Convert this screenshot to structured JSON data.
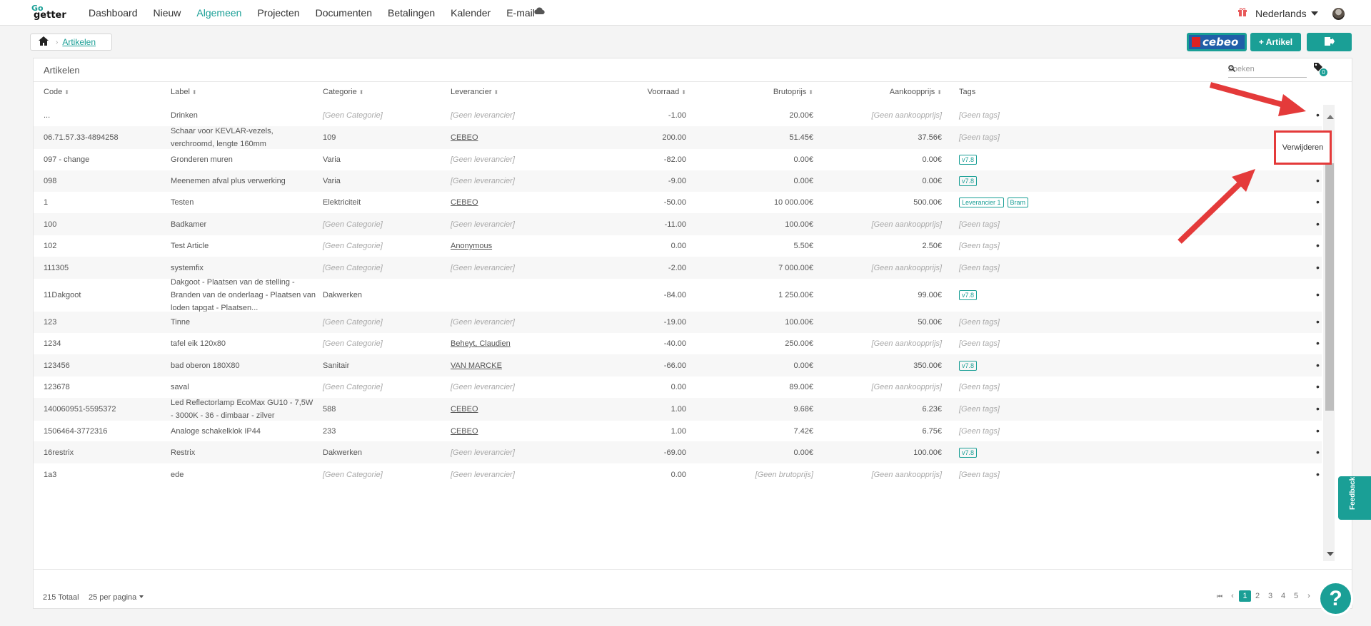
{
  "app": {
    "logo_top": "Go",
    "logo_bottom": "getter"
  },
  "nav": {
    "items": [
      "Dashboard",
      "Nieuw",
      "Algemeen",
      "Projecten",
      "Documenten",
      "Betalingen",
      "Kalender",
      "E-mail"
    ],
    "active": "Algemeen",
    "language": "Nederlands"
  },
  "breadcrumb": {
    "current": "Artikelen"
  },
  "toolbar": {
    "cebeo_label": "cebeo",
    "add_label": "+ Artikel"
  },
  "panel": {
    "title": "Artikelen",
    "search_placeholder": "Zoeken",
    "tag_count": "0"
  },
  "columns": [
    "Code",
    "Label",
    "Categorie",
    "Leverancier",
    "Voorraad",
    "Brutoprijs",
    "Aankoopprijs",
    "Tags"
  ],
  "rows": [
    {
      "code": "...",
      "label": "Drinken",
      "category": "[Geen Categorie]",
      "supplier": "[Geen leverancier]",
      "stock": "-1.00",
      "gross": "20.00€",
      "purchase": "[Geen aankoopprijs]",
      "tags": [],
      "no_tags": "[Geen tags]"
    },
    {
      "code": "06.71.57.33-4894258",
      "label": "Schaar voor KEVLAR-vezels, verchroomd, lengte 160mm",
      "category": "109",
      "supplier": "CEBEO",
      "stock": "200.00",
      "gross": "51.45€",
      "purchase": "37.56€",
      "tags": [],
      "no_tags": "[Geen tags]"
    },
    {
      "code": "097 - change",
      "label": "Gronderen muren",
      "category": "Varia",
      "supplier": "[Geen leverancier]",
      "stock": "-82.00",
      "gross": "0.00€",
      "purchase": "0.00€",
      "tags": [
        "v7.8"
      ]
    },
    {
      "code": "098",
      "label": "Meenemen afval plus verwerking",
      "category": "Varia",
      "supplier": "[Geen leverancier]",
      "stock": "-9.00",
      "gross": "0.00€",
      "purchase": "0.00€",
      "tags": [
        "v7.8"
      ]
    },
    {
      "code": "1",
      "label": "Testen",
      "category": "Elektriciteit",
      "supplier": "CEBEO",
      "stock": "-50.00",
      "gross": "10 000.00€",
      "purchase": "500.00€",
      "tags": [
        "Leverancier 1",
        "Bram"
      ]
    },
    {
      "code": "100",
      "label": "Badkamer",
      "category": "[Geen Categorie]",
      "supplier": "[Geen leverancier]",
      "stock": "-11.00",
      "gross": "100.00€",
      "purchase": "[Geen aankoopprijs]",
      "tags": [],
      "no_tags": "[Geen tags]"
    },
    {
      "code": "102",
      "label": "Test Article",
      "category": "[Geen Categorie]",
      "supplier": "Anonymous",
      "stock": "0.00",
      "gross": "5.50€",
      "purchase": "2.50€",
      "tags": [],
      "no_tags": "[Geen tags]"
    },
    {
      "code": "111305",
      "label": "systemfix",
      "category": "[Geen Categorie]",
      "supplier": "[Geen leverancier]",
      "stock": "-2.00",
      "gross": "7 000.00€",
      "purchase": "[Geen aankoopprijs]",
      "tags": [],
      "no_tags": "[Geen tags]"
    },
    {
      "code": "11Dakgoot",
      "label": "Dakgoot - Plaatsen van de stelling - Branden van de onderlaag - Plaatsen van loden tapgat - Plaatsen...",
      "category": "Dakwerken",
      "supplier": "",
      "stock": "-84.00",
      "gross": "1 250.00€",
      "purchase": "99.00€",
      "tags": [
        "v7.8"
      ]
    },
    {
      "code": "123",
      "label": "Tinne",
      "category": "[Geen Categorie]",
      "supplier": "[Geen leverancier]",
      "stock": "-19.00",
      "gross": "100.00€",
      "purchase": "50.00€",
      "tags": [],
      "no_tags": "[Geen tags]"
    },
    {
      "code": "1234",
      "label": "tafel eik 120x80",
      "category": "[Geen Categorie]",
      "supplier": "Beheyt, Claudien",
      "stock": "-40.00",
      "gross": "250.00€",
      "purchase": "[Geen aankoopprijs]",
      "tags": [],
      "no_tags": "[Geen tags]"
    },
    {
      "code": "123456",
      "label": "bad oberon 180X80",
      "category": "Sanitair",
      "supplier": "VAN MARCKE",
      "stock": "-66.00",
      "gross": "0.00€",
      "purchase": "350.00€",
      "tags": [
        "v7.8"
      ]
    },
    {
      "code": "123678",
      "label": "saval",
      "category": "[Geen Categorie]",
      "supplier": "[Geen leverancier]",
      "stock": "0.00",
      "gross": "89.00€",
      "purchase": "[Geen aankoopprijs]",
      "tags": [],
      "no_tags": "[Geen tags]"
    },
    {
      "code": "140060951-5595372",
      "label": "Led Reflectorlamp EcoMax GU10 - 7,5W - 3000K - 36 - dimbaar - zilver",
      "category": "588",
      "supplier": "CEBEO",
      "stock": "1.00",
      "gross": "9.68€",
      "purchase": "6.23€",
      "tags": [],
      "no_tags": "[Geen tags]"
    },
    {
      "code": "1506464-3772316",
      "label": "Analoge schakelklok IP44",
      "category": "233",
      "supplier": "CEBEO",
      "stock": "1.00",
      "gross": "7.42€",
      "purchase": "6.75€",
      "tags": [],
      "no_tags": "[Geen tags]"
    },
    {
      "code": "16restrix",
      "label": "Restrix",
      "category": "Dakwerken",
      "supplier": "[Geen leverancier]",
      "stock": "-69.00",
      "gross": "0.00€",
      "purchase": "100.00€",
      "tags": [
        "v7.8"
      ]
    },
    {
      "code": "1a3",
      "label": "ede",
      "category": "[Geen Categorie]",
      "supplier": "[Geen leverancier]",
      "stock": "0.00",
      "gross": "[Geen brutoprijs]",
      "purchase": "[Geen aankoopprijs]",
      "tags": [],
      "no_tags": "[Geen tags]"
    }
  ],
  "context_menu": {
    "delete_label": "Verwijderen"
  },
  "footer": {
    "total": "215 Totaal",
    "per_page": "25 per pagina",
    "pages": [
      "1",
      "2",
      "3",
      "4",
      "5"
    ],
    "current_page": "1"
  },
  "feedback_label": "Feedback",
  "help_label": "?",
  "colors": {
    "accent": "#1a9f96",
    "annotation": "#e43a3a"
  }
}
